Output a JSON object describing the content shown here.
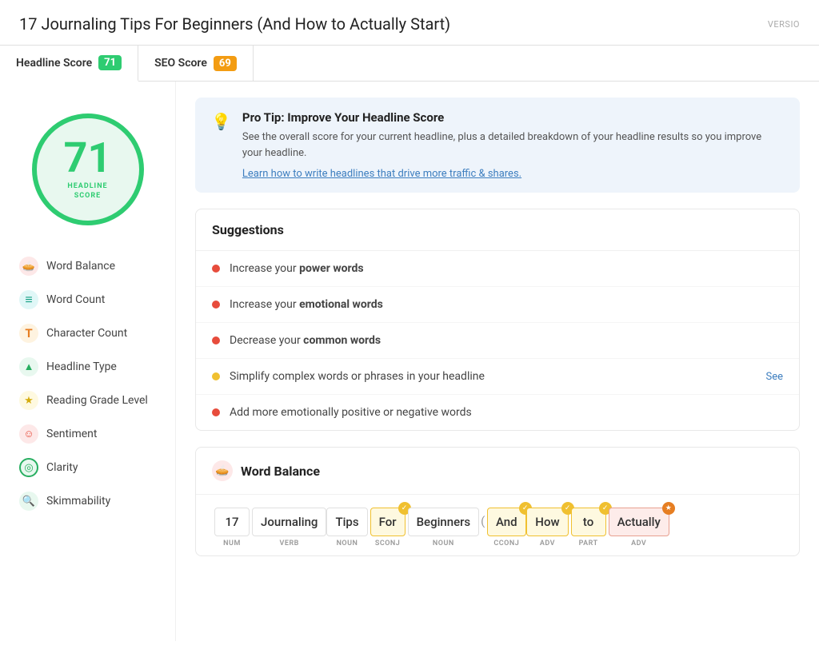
{
  "header": {
    "title": "17 Journaling Tips For Beginners (And How to Actually Start)",
    "version_label": "VERSIO"
  },
  "tabs": [
    {
      "id": "headline",
      "label": "Headline Score",
      "badge": "71",
      "badge_color": "green",
      "active": true
    },
    {
      "id": "seo",
      "label": "SEO Score",
      "badge": "69",
      "badge_color": "yellow",
      "active": false
    }
  ],
  "score": {
    "value": "71",
    "label_line1": "HEADLINE",
    "label_line2": "SCORE"
  },
  "sidebar": {
    "items": [
      {
        "id": "word-balance",
        "label": "Word Balance",
        "icon": "🥧",
        "icon_class": "icon-pink"
      },
      {
        "id": "word-count",
        "label": "Word Count",
        "icon": "≡",
        "icon_class": "icon-teal"
      },
      {
        "id": "character-count",
        "label": "Character Count",
        "icon": "T",
        "icon_class": "icon-orange"
      },
      {
        "id": "headline-type",
        "label": "Headline Type",
        "icon": "△",
        "icon_class": "icon-green-soft"
      },
      {
        "id": "reading-grade",
        "label": "Reading Grade Level",
        "icon": "★",
        "icon_class": "icon-yellow"
      },
      {
        "id": "sentiment",
        "label": "Sentiment",
        "icon": "☺",
        "icon_class": "icon-red-soft"
      },
      {
        "id": "clarity",
        "label": "Clarity",
        "icon": "◎",
        "icon_class": "icon-green-ring"
      },
      {
        "id": "skimmability",
        "label": "Skimmability",
        "icon": "🔍",
        "icon_class": "icon-green-search"
      }
    ]
  },
  "pro_tip": {
    "title": "Pro Tip: Improve Your Headline Score",
    "text": "See the overall score for your current headline, plus a detailed breakdown of your headline results so you improve your headline.",
    "link_text": "Learn how to write headlines that drive more traffic & shares."
  },
  "suggestions": {
    "section_title": "Suggestions",
    "items": [
      {
        "type": "red",
        "text_before": "Increase your ",
        "text_bold": "power words",
        "text_after": "",
        "see_link": false
      },
      {
        "type": "red",
        "text_before": "Increase your ",
        "text_bold": "emotional words",
        "text_after": "",
        "see_link": false
      },
      {
        "type": "red",
        "text_before": "Decrease your ",
        "text_bold": "common words",
        "text_after": "",
        "see_link": false
      },
      {
        "type": "yellow",
        "text_before": "Simplify complex words or phrases in your headline",
        "text_bold": "",
        "text_after": "",
        "see_link": true,
        "see_text": "See"
      },
      {
        "type": "red",
        "text_before": "Add more emotionally positive or negative words",
        "text_bold": "",
        "text_after": "",
        "see_link": false
      }
    ]
  },
  "word_balance": {
    "section_title": "Word Balance",
    "tokens": [
      {
        "word": "17",
        "type": "NUM",
        "highlight": "",
        "badge": ""
      },
      {
        "word": "Journaling",
        "type": "VERB",
        "highlight": "",
        "badge": ""
      },
      {
        "word": "Tips",
        "type": "NOUN",
        "highlight": "",
        "badge": ""
      },
      {
        "word": "For",
        "type": "SCONJ",
        "highlight": "yellow",
        "badge": "yellow"
      },
      {
        "word": "Beginners",
        "type": "NOUN",
        "highlight": "",
        "badge": ""
      },
      {
        "word": "(",
        "type": "",
        "highlight": "",
        "badge": "",
        "is_paren": true
      },
      {
        "word": "And",
        "type": "CCONJ",
        "highlight": "yellow",
        "badge": "yellow"
      },
      {
        "word": "How",
        "type": "ADV",
        "highlight": "yellow",
        "badge": "yellow"
      },
      {
        "word": "to",
        "type": "PART",
        "highlight": "yellow",
        "badge": "yellow"
      },
      {
        "word": "Actually",
        "type": "ADV",
        "highlight": "pink",
        "badge": "orange"
      }
    ]
  }
}
